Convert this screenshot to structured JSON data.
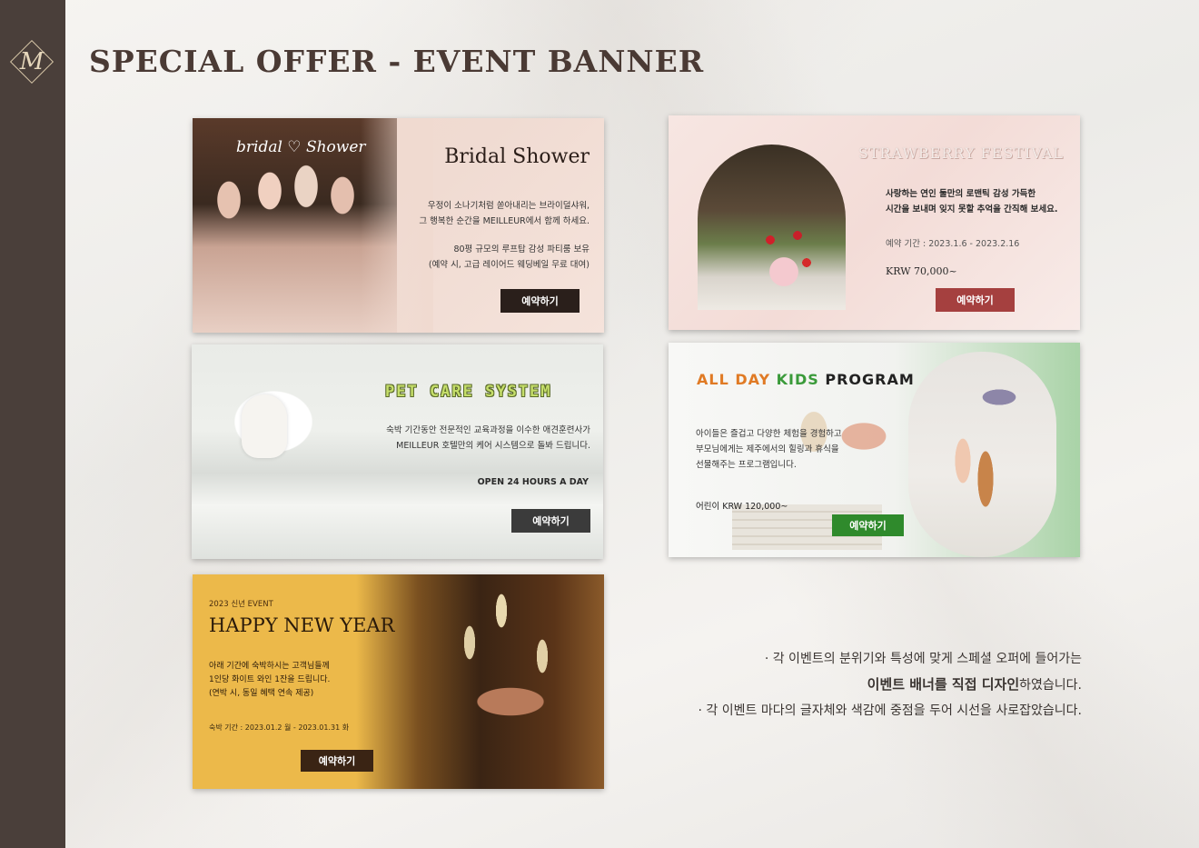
{
  "logo_letter": "M",
  "title": "SPECIAL OFFER  -  EVENT BANNER",
  "bridal": {
    "script_text": "bridal ♡ Shower",
    "title": "Bridal Shower",
    "line1": "우정이 소나기처럼 쏟아내리는 브라이덜샤워,",
    "line2": "그 행복한 순간을 MEILLEUR에서 함께 하세요.",
    "line3": "80평 규모의 루프탑 감성 파티룸 보유",
    "line4": "(예약 시, 고급 레이어드 웨딩베일 무료 대여)",
    "button": "예약하기",
    "button_color": "#2a1f1b"
  },
  "strawberry": {
    "title": "STRAWBERRY FESTIVAL",
    "line1": "사랑하는 연인 둘만의 로맨틱 감성 가득한",
    "line2": "시간을 보내며 잊지 못할 추억을 간직해 보세요.",
    "period": "예약 기간 : 2023.1.6 - 2023.2.16",
    "price": "KRW 70,000~",
    "button": "예약하기",
    "button_color": "#a5403f"
  },
  "pet": {
    "title": "PET CARE SYSTEM",
    "line1": "숙박 기간동안 전문적인 교육과정을 이수한 애견훈련사가",
    "line2": "MEILLEUR 호텔만의 케어 시스템으로 돌봐 드립니다.",
    "hours": "OPEN 24 HOURS A DAY",
    "button": "예약하기",
    "button_color": "#3b3b3b"
  },
  "kids": {
    "title_parts": [
      "ALL DAY ",
      "KIDS ",
      "PROGRAM"
    ],
    "title_colors": [
      "#e07a24",
      "#3a9a3a",
      "#222222"
    ],
    "line1": "아이들은 즐겁고 다양한 체험을 경험하고",
    "line2": "부모님에게는 제주에서의 힐링과 휴식을",
    "line3": "선물해주는 프로그램입니다.",
    "price": "어린이 KRW 120,000~",
    "button": "예약하기",
    "button_color": "#2f8a2c"
  },
  "newyear": {
    "sub": "2023 신년 EVENT",
    "title": "HAPPY NEW YEAR",
    "line1": "아래 기간에 숙박하시는 고객님들께",
    "line2": "1인당 화이트 와인 1잔을 드립니다.",
    "line3": "(연박 시, 동일 혜택 연속 제공)",
    "period": "숙박 기간 : 2023.01.2 월 - 2023.01.31 화",
    "button": "예약하기",
    "button_color": "#3a2414"
  },
  "caption": {
    "line1": "· 각 이벤트의 분위기와  특성에 맞게  스페셜 오퍼에 들어가는",
    "line2_bold": "이벤트 배너를 직접 디자인",
    "line2_rest": "하였습니다.",
    "line3": "· 각 이벤트 마다의 글자체와 색감에 중점을 두어 시선을 사로잡았습니다."
  }
}
